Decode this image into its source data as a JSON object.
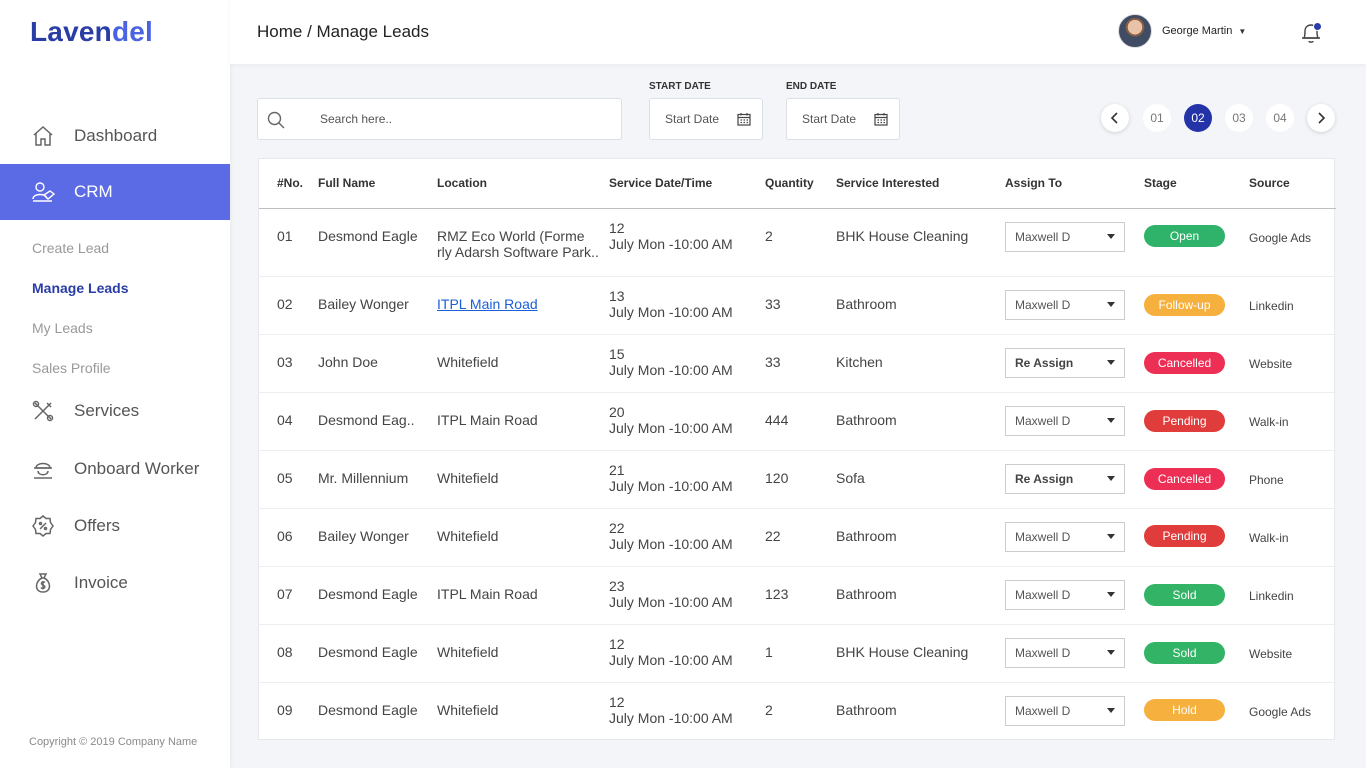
{
  "brand": {
    "part1": "Laven",
    "part2": "del"
  },
  "sidebar": {
    "items": [
      {
        "label": "Dashboard",
        "icon": "home-icon"
      },
      {
        "label": "CRM",
        "icon": "crm-icon"
      },
      {
        "label": "Services",
        "icon": "tools-icon"
      },
      {
        "label": "Onboard Worker",
        "icon": "worker-icon"
      },
      {
        "label": "Offers",
        "icon": "offer-badge-icon"
      },
      {
        "label": "Invoice",
        "icon": "money-bag-icon"
      }
    ],
    "sub_items": [
      {
        "label": "Create Lead"
      },
      {
        "label": "Manage Leads"
      },
      {
        "label": "My Leads"
      },
      {
        "label": "Sales Profile"
      }
    ],
    "copyright": "Copyright © 2019 Company Name"
  },
  "header": {
    "breadcrumb": "Home / Manage Leads",
    "user_name": "George Martin",
    "accent_color": "#2a3ca6"
  },
  "filters": {
    "search_placeholder": "Search here..",
    "start_label": "START DATE",
    "start_value": "Start Date",
    "end_label": "END DATE",
    "end_value": "Start Date"
  },
  "pagination": {
    "pages": [
      "01",
      "02",
      "03",
      "04"
    ],
    "current": "02"
  },
  "table": {
    "columns": [
      "#No.",
      "Full Name",
      "Location",
      "Service Date/Time",
      "Quantity",
      "Service Interested",
      "Assign To",
      "Stage",
      "Source"
    ],
    "rows": [
      {
        "no": "01",
        "name": "Desmond Eagle",
        "location_1": "RMZ Eco World (Forme",
        "location_2": "rly Adarsh Software Park..",
        "day": "12",
        "time": "July Mon -10:00 AM",
        "qty": "2",
        "service": "BHK House Cleaning",
        "assign": "Maxwell D",
        "stage": "Open",
        "source": "Google Ads"
      },
      {
        "no": "02",
        "name": "Bailey Wonger",
        "location_1": "ITPL Main Road",
        "day": "13",
        "time": "July Mon -10:00 AM",
        "qty": "33",
        "service": "Bathroom",
        "assign": "Maxwell D",
        "stage": "Follow-up",
        "source": "Linkedin"
      },
      {
        "no": "03",
        "name": "John Doe",
        "location_1": "Whitefield",
        "day": "15",
        "time": "July Mon -10:00 AM",
        "qty": "33",
        "service": "Kitchen",
        "assign": "Re Assign",
        "stage": "Cancelled",
        "source": "Website"
      },
      {
        "no": "04",
        "name": "Desmond Eag..",
        "location_1": "ITPL Main Road",
        "day": "20",
        "time": "July Mon -10:00 AM",
        "qty": "444",
        "service": "Bathroom",
        "assign": "Maxwell D",
        "stage": "Pending",
        "source": "Walk-in"
      },
      {
        "no": "05",
        "name": "Mr. Millennium",
        "location_1": "Whitefield",
        "day": "21",
        "time": "July Mon -10:00 AM",
        "qty": "120",
        "service": "Sofa",
        "assign": "Re Assign",
        "stage": "Cancelled",
        "source": "Phone"
      },
      {
        "no": "06",
        "name": "Bailey Wonger",
        "location_1": "Whitefield",
        "day": "22",
        "time": "July Mon -10:00 AM",
        "qty": "22",
        "service": "Bathroom",
        "assign": "Maxwell D",
        "stage": "Pending",
        "source": "Walk-in"
      },
      {
        "no": "07",
        "name": "Desmond Eagle",
        "location_1": "ITPL Main Road",
        "day": "23",
        "time": "July Mon -10:00 AM",
        "qty": "123",
        "service": "Bathroom",
        "assign": "Maxwell D",
        "stage": "Sold",
        "source": "Linkedin"
      },
      {
        "no": "08",
        "name": "Desmond Eagle",
        "location_1": "Whitefield",
        "day": "12",
        "time": "July Mon -10:00 AM",
        "qty": "1",
        "service": "BHK House Cleaning",
        "assign": "Maxwell D",
        "stage": "Sold",
        "source": "Website"
      },
      {
        "no": "09",
        "name": "Desmond Eagle",
        "location_1": "Whitefield",
        "day": "12",
        "time": "July Mon -10:00 AM",
        "qty": "2",
        "service": "Bathroom",
        "assign": "Maxwell D",
        "stage": "Hold",
        "source": "Google Ads"
      }
    ]
  },
  "stage_colors": {
    "Open": "#2fb36a",
    "Follow-up": "#f6b03e",
    "Cancelled": "#ee2f55",
    "Pending": "#e03c3c",
    "Sold": "#33b366",
    "Hold": "#f6b03e"
  }
}
